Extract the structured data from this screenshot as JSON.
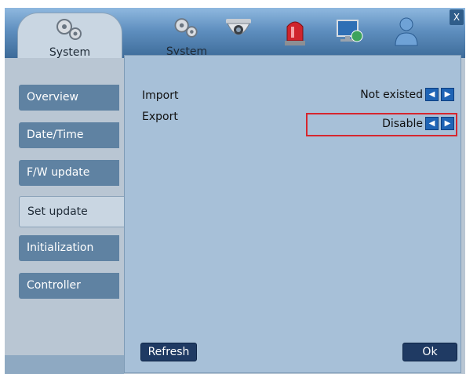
{
  "tabs": [
    {
      "label": "System",
      "icon": "gears-icon"
    },
    {
      "label": "System",
      "icon": "gears-icon"
    },
    {
      "label": "",
      "icon": "camera-dome-icon"
    },
    {
      "label": "",
      "icon": "alarm-siren-icon"
    },
    {
      "label": "",
      "icon": "network-monitor-icon"
    },
    {
      "label": "",
      "icon": "user-icon"
    }
  ],
  "close_label": "X",
  "sidebar": {
    "items": [
      {
        "label": "Overview"
      },
      {
        "label": "Date/Time"
      },
      {
        "label": "F/W update"
      },
      {
        "label": "Set update"
      },
      {
        "label": "Initialization"
      },
      {
        "label": "Controller"
      }
    ],
    "active_index": 3
  },
  "settings": [
    {
      "label": "Import",
      "value": "Not existed"
    },
    {
      "label": "Export",
      "value": "Disable"
    }
  ],
  "arrows": {
    "left": "◀",
    "right": "▶"
  },
  "buttons": {
    "refresh": "Refresh",
    "ok": "Ok"
  },
  "colors": {
    "highlight_border": "#d6262e",
    "button_bg": "#1f3a63",
    "arrow_bg": "#1f64b5"
  }
}
